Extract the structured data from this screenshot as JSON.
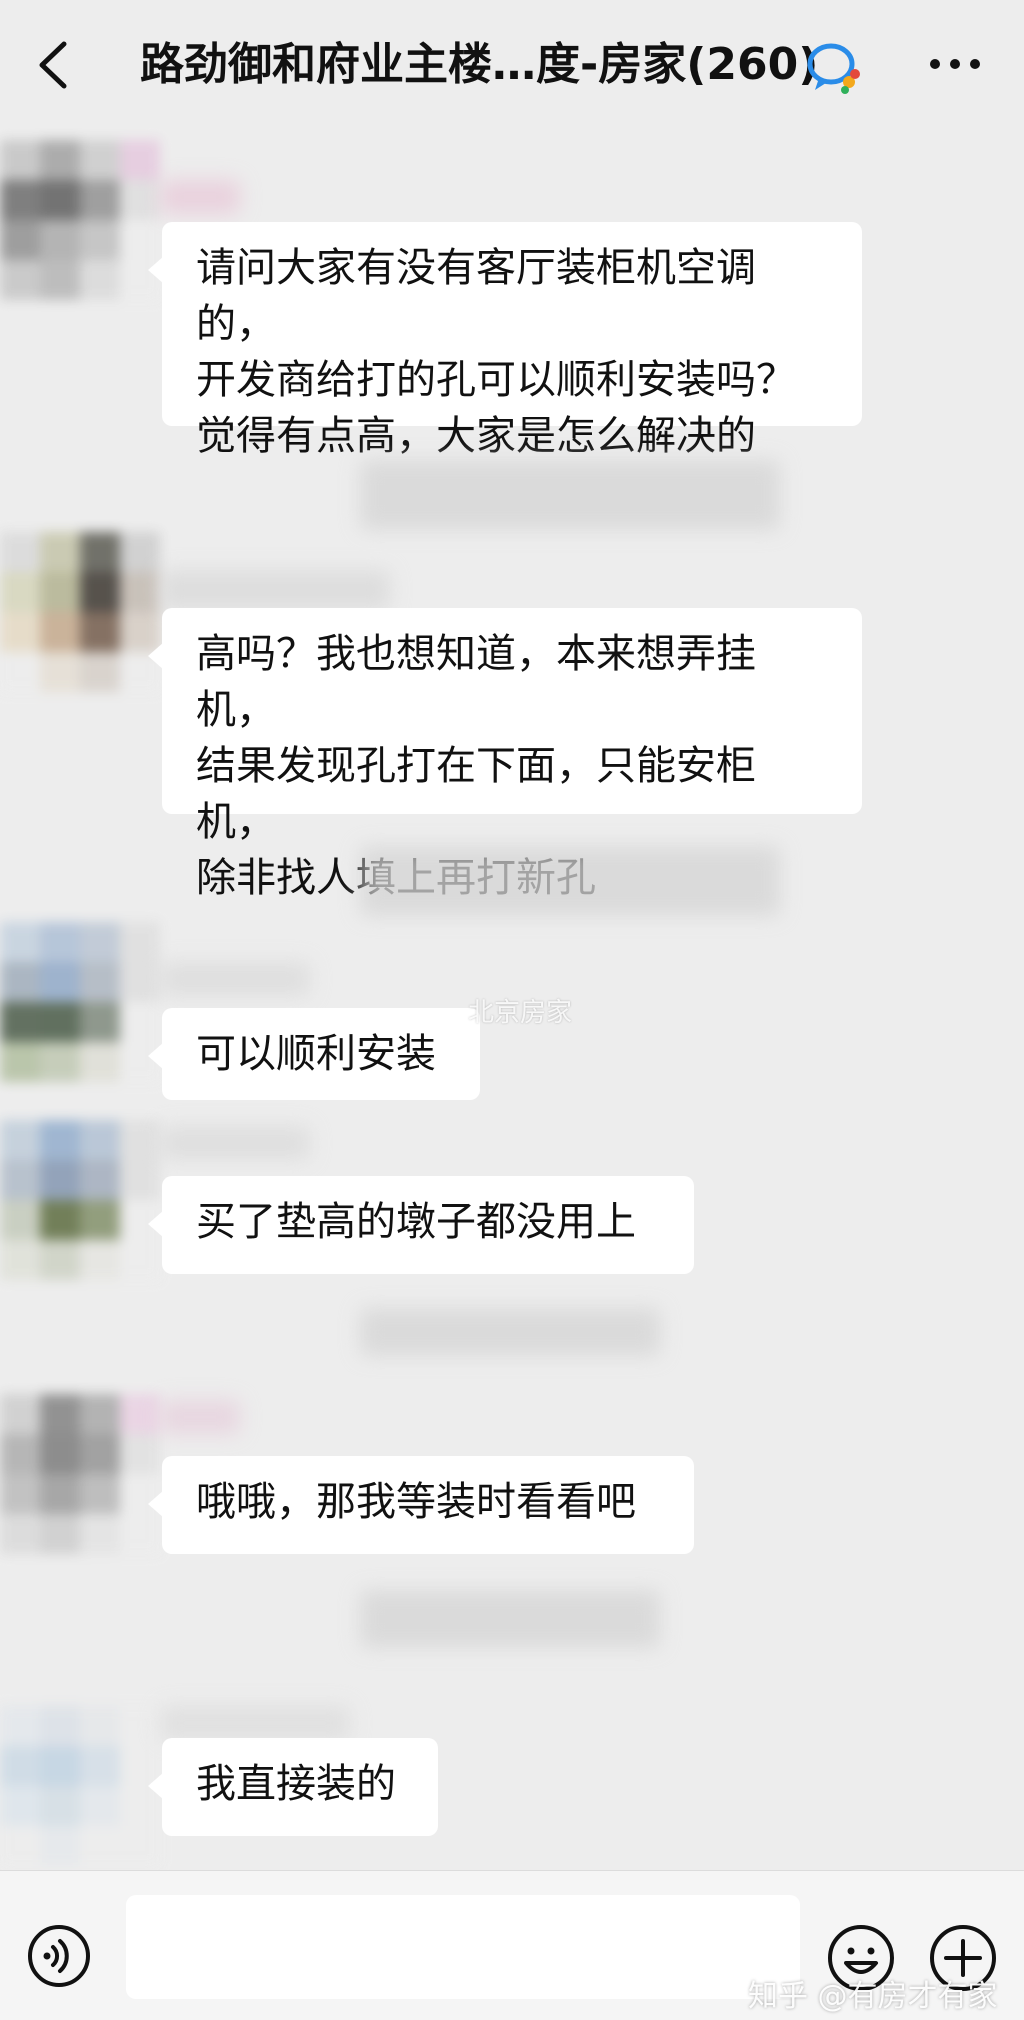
{
  "header": {
    "title": "路劲御和府业主楼…度-房家(260)",
    "back_icon": "chevron-left-icon",
    "chat_icon": "wecom-chat-icon",
    "more_icon": "more-dots-icon"
  },
  "messages": [
    {
      "text": "请问大家有没有客厅装柜机空调的，\n开发商给打的孔可以顺利安装吗？\n觉得有点高，大家是怎么解决的"
    },
    {
      "text": "高吗？我也想知道，本来想弄挂机，\n结果发现孔打在下面，只能安柜机，\n除非找人填上再打新孔"
    },
    {
      "text": "可以顺利安装"
    },
    {
      "text": "买了垫高的墩子都没用上"
    },
    {
      "text": "哦哦，那我等装时看看吧"
    },
    {
      "text": "我直接装的"
    }
  ],
  "watermarks": {
    "center": "北京房家",
    "footer": "知乎 @有房才有家"
  },
  "footer": {
    "voice_icon": "voice-icon",
    "emoji_icon": "emoji-icon",
    "plus_icon": "plus-icon",
    "input_value": ""
  },
  "colors": {
    "background": "#ededed",
    "bubble": "#ffffff",
    "footer": "#f5f5f5"
  }
}
